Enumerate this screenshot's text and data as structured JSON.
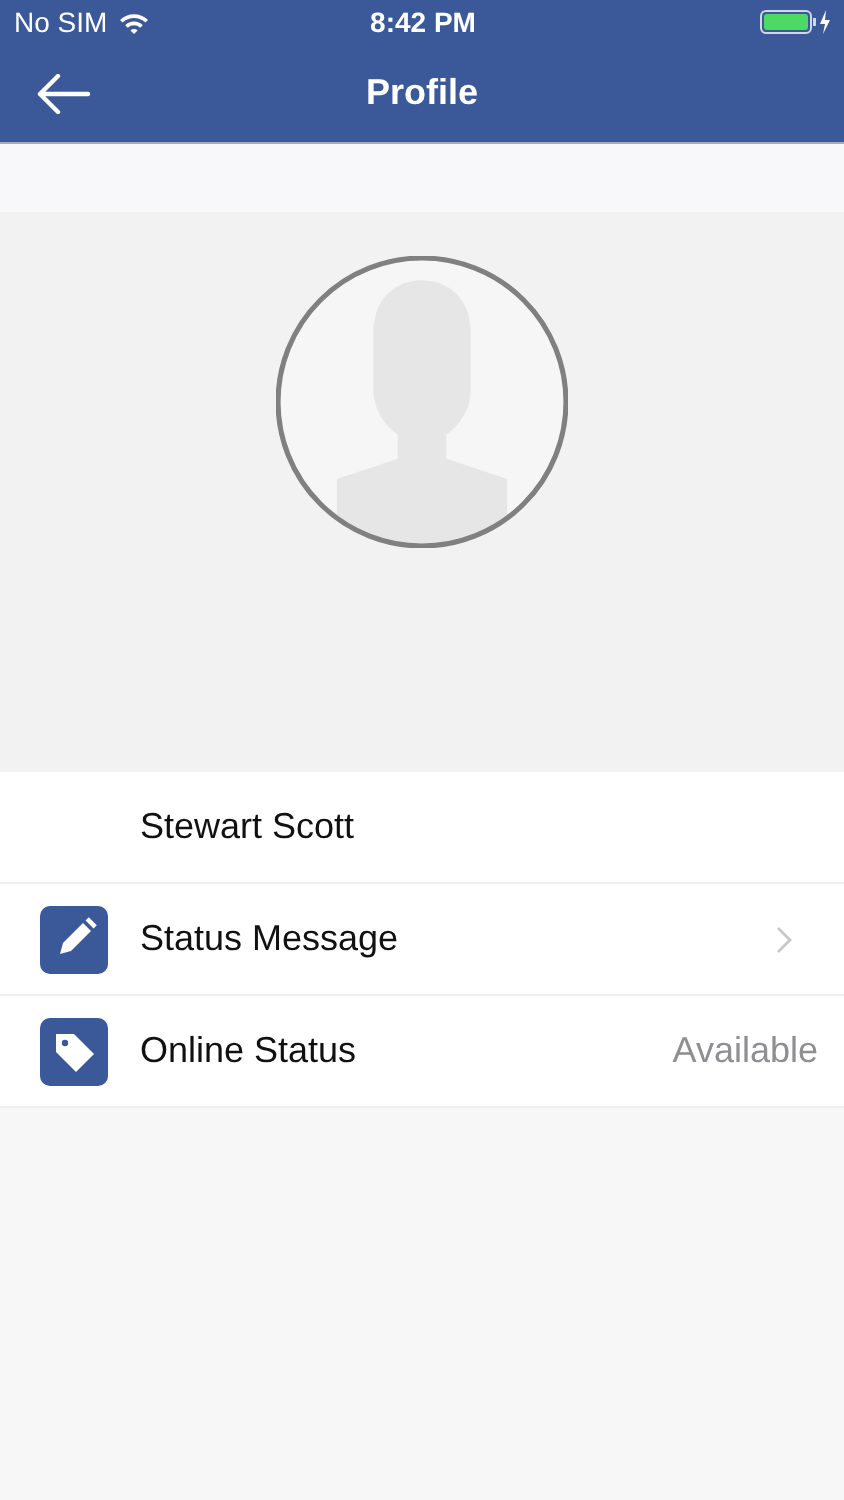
{
  "status_bar": {
    "carrier": "No SIM",
    "time": "8:42 PM"
  },
  "nav_bar": {
    "title": "Profile"
  },
  "profile": {
    "kind": "avatar"
  },
  "rows": [
    {
      "kind": "plain",
      "label": "Stewart Scott"
    },
    {
      "kind": "link",
      "label": "Status Message"
    },
    {
      "kind": "value",
      "label": "Online Status",
      "value": "Available"
    }
  ]
}
